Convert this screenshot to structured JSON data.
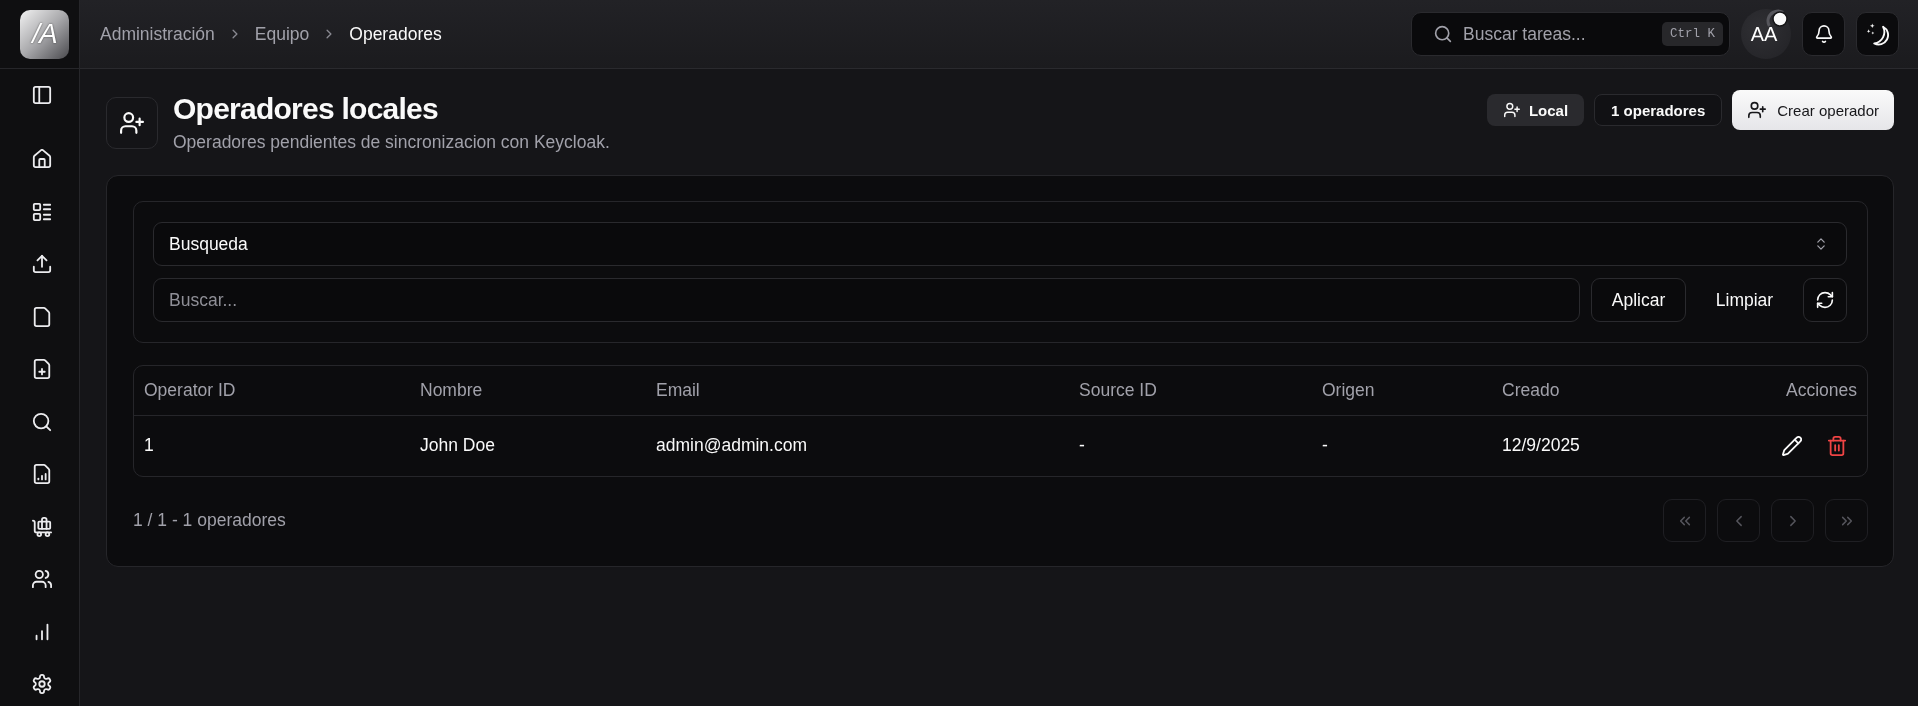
{
  "app": {
    "logo_text": "/A"
  },
  "breadcrumb": [
    {
      "label": "Administración",
      "current": false
    },
    {
      "label": "Equipo",
      "current": false
    },
    {
      "label": "Operadores",
      "current": true
    }
  ],
  "header": {
    "search": {
      "placeholder": "Buscar tareas...",
      "shortcut": "Ctrl K"
    },
    "user": {
      "initials": "AA"
    }
  },
  "page": {
    "title": "Operadores locales",
    "subtitle": "Operadores pendientes de sincronizacion con Keycloak.",
    "badges": [
      {
        "kind": "source",
        "label": "Local"
      },
      {
        "kind": "count",
        "label": "1 operadores"
      }
    ],
    "primary_action": "Crear operador"
  },
  "filters": {
    "field": {
      "value": "Busqueda"
    },
    "search": {
      "placeholder": "Buscar..."
    },
    "buttons": [
      {
        "kind": "outline",
        "label": "Aplicar"
      },
      {
        "kind": "ghost",
        "label": "Limpiar"
      }
    ]
  },
  "table": {
    "columns": [
      "Operator ID",
      "Nombre",
      "Email",
      "Source ID",
      "Origen",
      "Creado",
      "Acciones"
    ],
    "rows": [
      {
        "cells": [
          "1",
          "John Doe",
          "admin@admin.com",
          "-",
          "-",
          "12/9/2025"
        ]
      }
    ]
  },
  "pagination": {
    "summary": "1 / 1 - 1 operadores",
    "buttons": [
      {
        "kind": "first",
        "disabled": true
      },
      {
        "kind": "previous",
        "disabled": true
      },
      {
        "kind": "next",
        "disabled": true
      },
      {
        "kind": "last",
        "disabled": true
      }
    ]
  }
}
